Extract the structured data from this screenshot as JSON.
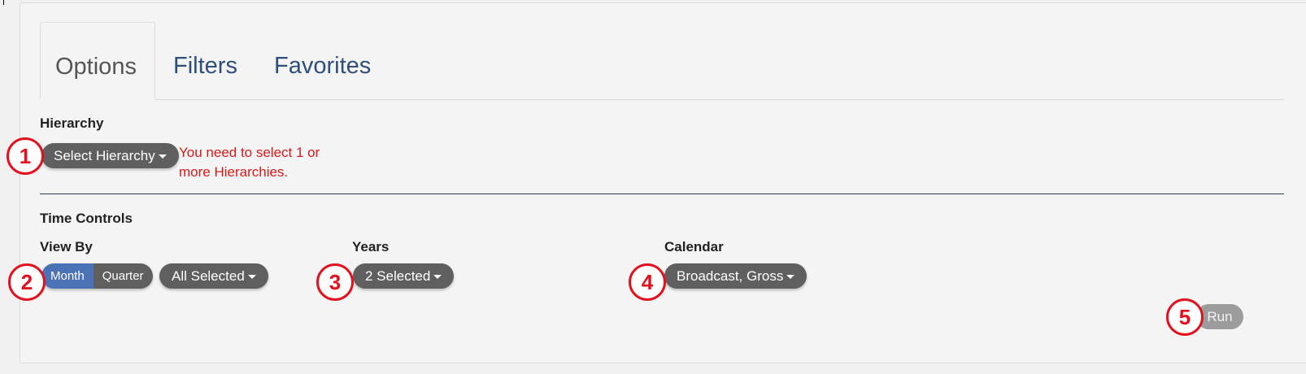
{
  "tabs": [
    {
      "label": "Options",
      "active": true
    },
    {
      "label": "Filters",
      "active": false
    },
    {
      "label": "Favorites",
      "active": false
    }
  ],
  "hierarchy": {
    "label": "Hierarchy",
    "button_label": "Select Hierarchy",
    "error_message": "You need to select 1 or more Hierarchies."
  },
  "time_controls": {
    "label": "Time Controls",
    "view_by": {
      "label": "View By",
      "options": [
        "Month",
        "Quarter"
      ],
      "selected": "Month",
      "dropdown_label": "All Selected"
    },
    "years": {
      "label": "Years",
      "dropdown_label": "2 Selected"
    },
    "calendar": {
      "label": "Calendar",
      "dropdown_label": "Broadcast, Gross"
    }
  },
  "run_label": "Run",
  "markers": [
    "1",
    "2",
    "3",
    "4",
    "5"
  ],
  "colors": {
    "tab_link": "#2f4f7a",
    "pill_bg": "#5f5f5f",
    "segment_active": "#4a72b5",
    "error": "#d61a1a",
    "marker": "#e3101e",
    "run_disabled": "#9c9c9c"
  }
}
